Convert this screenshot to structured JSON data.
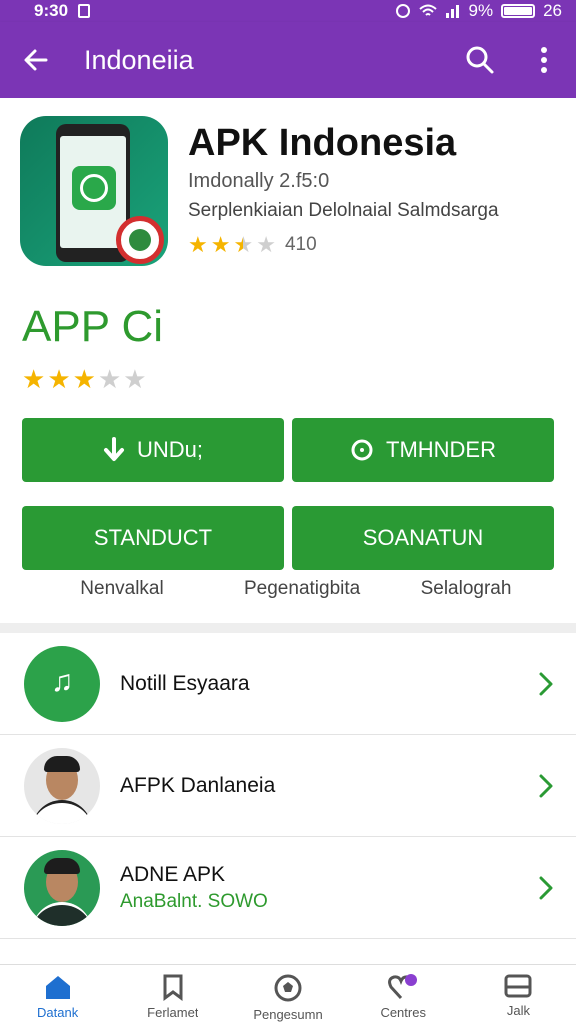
{
  "status_bar": {
    "time": "9:30",
    "battery": "9%",
    "extra": "26"
  },
  "app_bar": {
    "title": "Indoneiia"
  },
  "app": {
    "name": "APK Indonesia",
    "meta_line1": "Imdonally 2.f5:0",
    "meta_line2": "Serplenkiaian Delolnaial Salmdsarga",
    "rating_count": "410",
    "rating_stars": 2.5
  },
  "section": {
    "title": "APP Ci",
    "stars": 3
  },
  "buttons": {
    "download": "UNDu;",
    "tmhnder": "TMHNDER",
    "standuct": "STANDUCT",
    "soanatun": "SOANATUN"
  },
  "labels": [
    "Nenvalkal",
    "Pegenatigbita",
    "Selalograh"
  ],
  "list": [
    {
      "title": "Notill Esyaara",
      "subtitle": ""
    },
    {
      "title": "AFPK Danlaneia",
      "subtitle": ""
    },
    {
      "title": "ADNE APK",
      "subtitle": "AnaBalnt. SOWO"
    }
  ],
  "bottom_nav": [
    {
      "label": "Datank",
      "icon": "home-icon"
    },
    {
      "label": "Ferlamet",
      "icon": "bookmark-icon"
    },
    {
      "label": "Pengesumn",
      "icon": "soccer-ball-icon"
    },
    {
      "label": "Centres",
      "icon": "heart-icon"
    },
    {
      "label": "Jalk",
      "icon": "inbox-icon"
    }
  ],
  "colors": {
    "primary": "#7b35b5",
    "green": "#2a9a34",
    "active": "#1e6fd0"
  }
}
